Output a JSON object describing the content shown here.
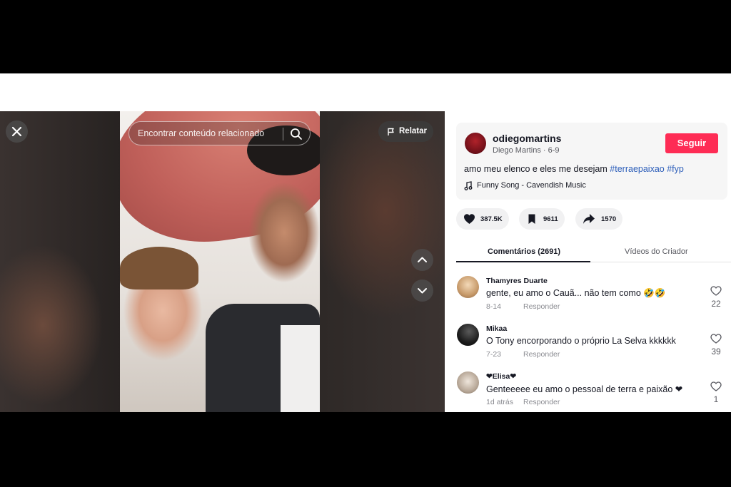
{
  "video": {
    "search_placeholder": "Encontrar conteúdo relacionado",
    "report_label": "Relatar"
  },
  "post": {
    "username": "odiegomartins",
    "display_name": "Diego Martins",
    "date": "6-9",
    "follow_label": "Seguir",
    "caption_text": "amo meu elenco e eles me desejam",
    "hashtags": [
      "#terraepaixao",
      "#fyp"
    ],
    "music": "Funny Song - Cavendish Music",
    "likes": "387.5K",
    "saves": "9611",
    "shares": "1570"
  },
  "tabs": {
    "comments": "Comentários (2691)",
    "creator_videos": "Vídeos do Criador"
  },
  "comments": [
    {
      "name": "Thamyres Duarte",
      "text": "gente, eu amo o Cauã... não tem como 🤣🤣",
      "date": "8-14",
      "reply": "Responder",
      "likes": "22"
    },
    {
      "name": "Mikaa",
      "text": "O Tony encorporando o próprio La Selva kkkkkk",
      "date": "7-23",
      "reply": "Responder",
      "likes": "39"
    },
    {
      "name": "❤Elisa❤",
      "text": "Genteeeee eu amo o pessoal de terra e paixão ❤",
      "date": "1d atrás",
      "reply": "Responder",
      "likes": "1"
    }
  ],
  "colors": {
    "follow_button": "#fe2c55",
    "hashtag": "#2b5db9",
    "text_primary": "#161823",
    "text_secondary": "#8a8b91"
  },
  "icons": [
    "close-icon",
    "search-icon",
    "flag-icon",
    "chevron-up-icon",
    "chevron-down-icon",
    "music-note-icon",
    "heart-icon",
    "bookmark-icon",
    "share-arrow-icon"
  ]
}
